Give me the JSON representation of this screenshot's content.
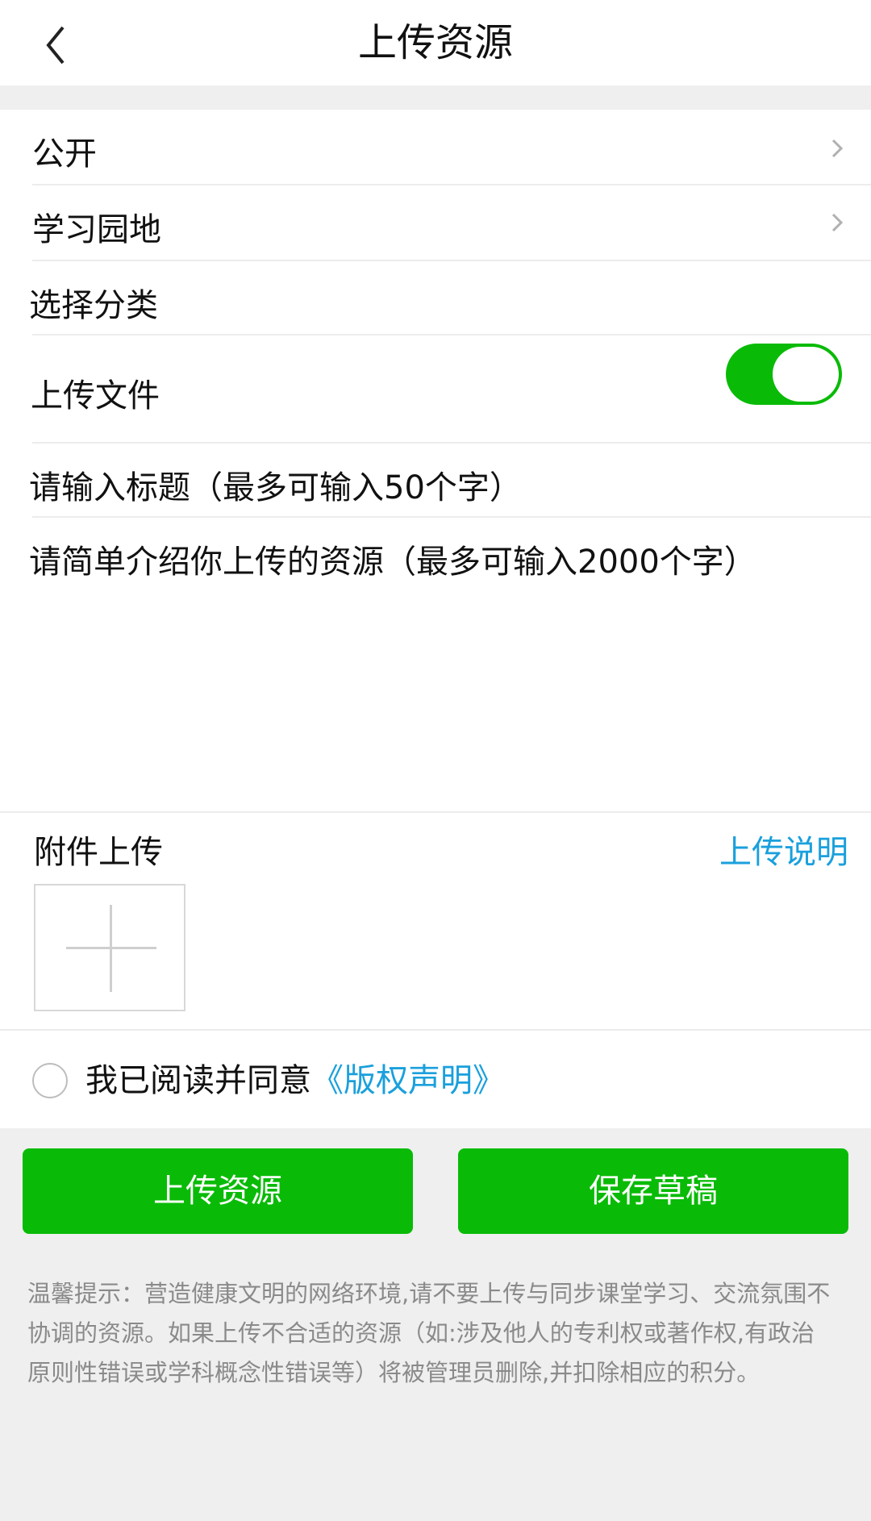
{
  "header": {
    "title": "上传资源"
  },
  "form": {
    "visibility": "公开",
    "board": "学习园地",
    "category_link": "选择分类",
    "upload_file_label": "上传文件",
    "upload_file_toggle_on": true,
    "title_placeholder": "请输入标题（最多可输入50个字）",
    "desc_placeholder": "请简单介绍你上传的资源（最多可输入2000个字）",
    "attachment_label": "附件上传",
    "upload_help_link": "上传说明"
  },
  "agreement": {
    "text": "我已阅读并同意",
    "link": "《版权声明》",
    "checked": false
  },
  "actions": {
    "upload_label": "上传资源",
    "save_draft_label": "保存草稿"
  },
  "tip": "温馨提示：营造健康文明的网络环境,请不要上传与同步课堂学习、交流氛围不协调的资源。如果上传不合适的资源（如:涉及他人的专利权或著作权,有政治原则性错误或学科概念性错误等）将被管理员删除,并扣除相应的积分。",
  "colors": {
    "accent_green": "#09bb07",
    "link_blue": "#1aa0dc"
  },
  "icons": {
    "back": "chevron-left-icon",
    "row_arrow": "chevron-right-icon",
    "add": "plus-icon"
  }
}
